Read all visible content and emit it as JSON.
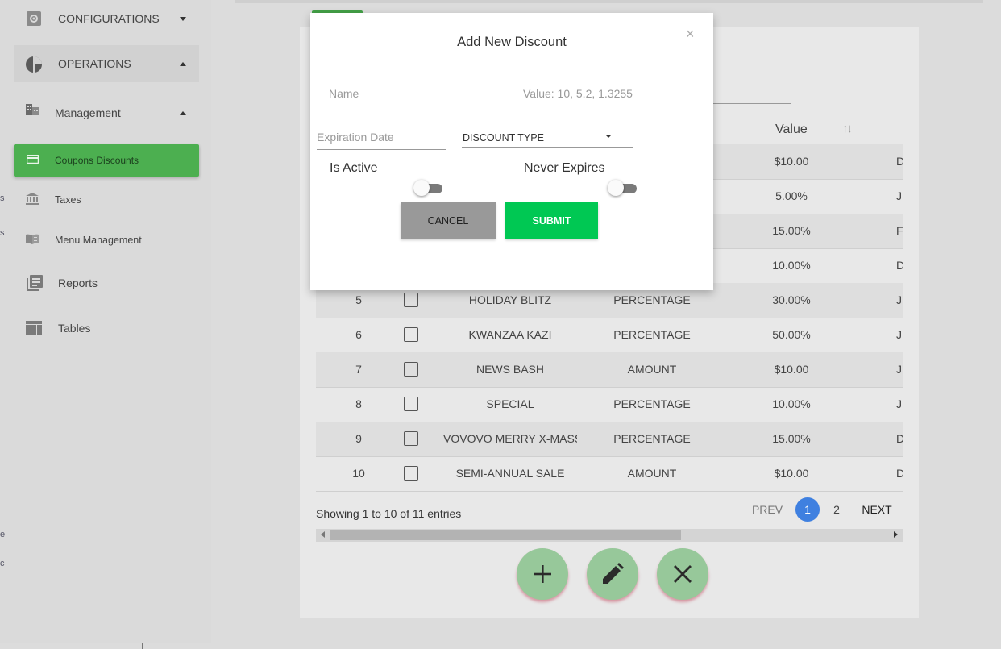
{
  "sidebar": {
    "items": [
      {
        "label": "CONFIGURATIONS",
        "icon": "gear-icon"
      },
      {
        "label": "OPERATIONS",
        "icon": "pie-chart-icon"
      },
      {
        "label": "Management",
        "icon": "building-icon"
      },
      {
        "label": "Coupons Discounts",
        "icon": "credit-card-icon"
      },
      {
        "label": "Taxes",
        "icon": "bank-icon"
      },
      {
        "label": "Menu Management",
        "icon": "menu-book-icon"
      },
      {
        "label": "Reports",
        "icon": "reports-icon"
      },
      {
        "label": "Tables",
        "icon": "table-icon"
      }
    ],
    "edge_chars": [
      "s",
      "s",
      "e",
      "c"
    ]
  },
  "table": {
    "value_header": "Value",
    "rows": [
      {
        "num": "",
        "name": "",
        "type": "",
        "value": "$10.00",
        "extra": "D"
      },
      {
        "num": "",
        "name": "",
        "type": "",
        "value": "5.00%",
        "extra": "J"
      },
      {
        "num": "",
        "name": "",
        "type": "",
        "value": "15.00%",
        "extra": "F"
      },
      {
        "num": "",
        "name": "",
        "type": "",
        "value": "10.00%",
        "extra": "D"
      },
      {
        "num": "5",
        "name": "HOLIDAY BLITZ",
        "type": "PERCENTAGE",
        "value": "30.00%",
        "extra": "J"
      },
      {
        "num": "6",
        "name": "KWANZAA KAZI",
        "type": "PERCENTAGE",
        "value": "50.00%",
        "extra": "J"
      },
      {
        "num": "7",
        "name": "NEWS BASH",
        "type": "AMOUNT",
        "value": "$10.00",
        "extra": "J"
      },
      {
        "num": "8",
        "name": "SPECIAL",
        "type": "PERCENTAGE",
        "value": "10.00%",
        "extra": "J"
      },
      {
        "num": "9",
        "name": "VOVOVO MERRY X-MASS",
        "type": "PERCENTAGE",
        "value": "15.00%",
        "extra": "D"
      },
      {
        "num": "10",
        "name": "SEMI-ANNUAL SALE",
        "type": "AMOUNT",
        "value": "$10.00",
        "extra": "D"
      }
    ],
    "showing": "Showing 1 to 10 of 11 entries"
  },
  "pagination": {
    "prev": "PREV",
    "pages": [
      "1",
      "2"
    ],
    "next": "NEXT"
  },
  "fabs": {
    "add_icon": "plus-icon",
    "edit_icon": "pencil-icon",
    "delete_icon": "close-icon"
  },
  "modal": {
    "title": "Add New Discount",
    "close": "×",
    "name_placeholder": "Name",
    "value_placeholder": "Value: 10, 5.2, 1.3255",
    "expiration_placeholder": "Expiration Date",
    "discount_type_label": "DISCOUNT TYPE",
    "is_active_label": "Is Active",
    "never_expires_label": "Never Expires",
    "cancel_label": "CANCEL",
    "submit_label": "SUBMIT"
  },
  "colors": {
    "accent_green": "#4caf50",
    "submit_green": "#00c853",
    "page_active_blue": "#3f80e0",
    "fab_green": "#97c89a"
  }
}
